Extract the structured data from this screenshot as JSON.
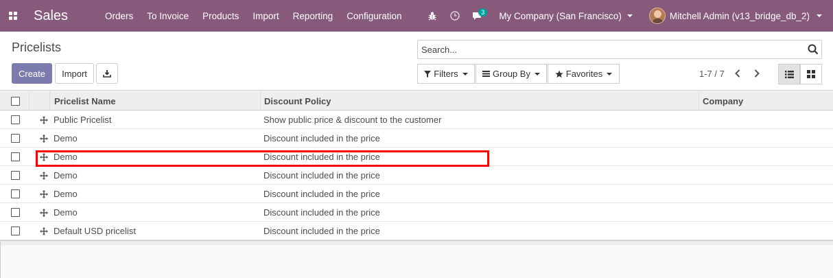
{
  "navbar": {
    "app_title": "Sales",
    "menu": [
      "Orders",
      "To Invoice",
      "Products",
      "Import",
      "Reporting",
      "Configuration"
    ],
    "message_count": "3",
    "company": "My Company (San Francisco)",
    "user": "Mitchell Admin (v13_bridge_db_2)",
    "color": "#875a7b"
  },
  "control_panel": {
    "title": "Pricelists",
    "create_label": "Create",
    "import_label": "Import",
    "search_placeholder": "Search...",
    "filters_label": "Filters",
    "groupby_label": "Group By",
    "favorites_label": "Favorites",
    "pager": "1-7 / 7"
  },
  "table": {
    "headers": {
      "name": "Pricelist Name",
      "policy": "Discount Policy",
      "company": "Company"
    },
    "rows": [
      {
        "name": "Public Pricelist",
        "policy": "Show public price & discount to the customer",
        "company": ""
      },
      {
        "name": "Demo",
        "policy": "Discount included in the price",
        "company": ""
      },
      {
        "name": "Demo",
        "policy": "Discount included in the price",
        "company": ""
      },
      {
        "name": "Demo",
        "policy": "Discount included in the price",
        "company": ""
      },
      {
        "name": "Demo",
        "policy": "Discount included in the price",
        "company": ""
      },
      {
        "name": "Demo",
        "policy": "Discount included in the price",
        "company": ""
      },
      {
        "name": "Default USD pricelist",
        "policy": "Discount included in the price",
        "company": ""
      }
    ]
  }
}
